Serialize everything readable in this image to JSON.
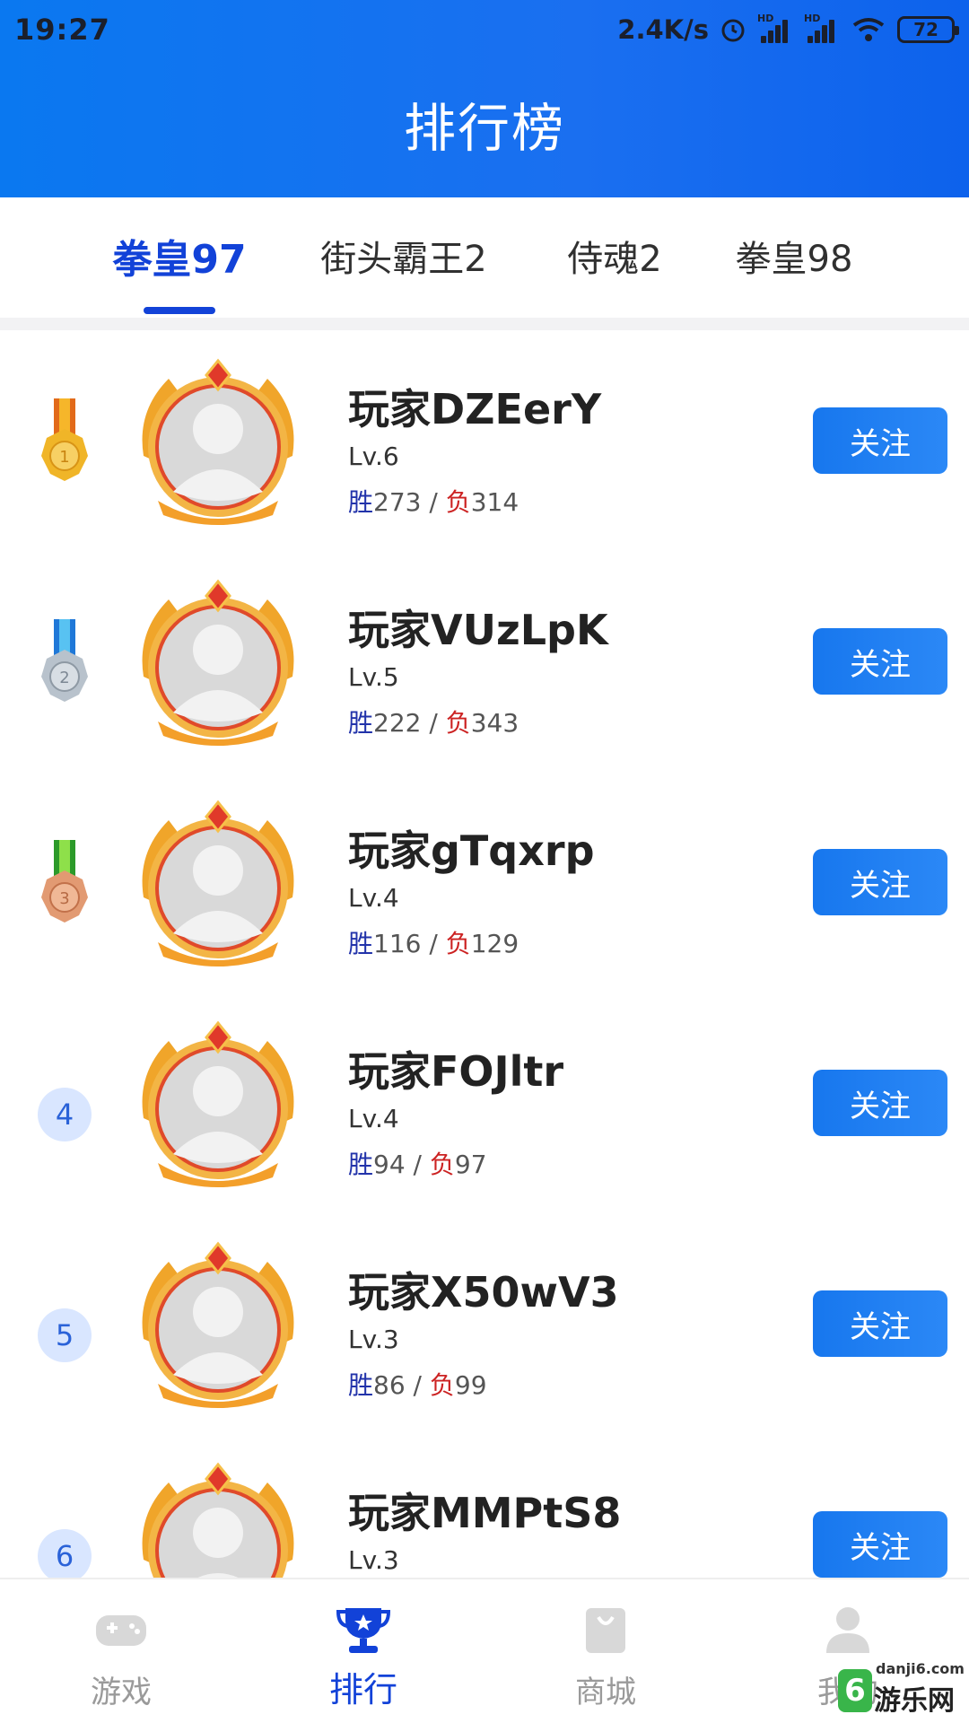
{
  "status_bar": {
    "time": "19:27",
    "network_speed": "2.4K/s",
    "hd_label": "HD",
    "battery": "72"
  },
  "header": {
    "title": "排行榜"
  },
  "tabs": [
    {
      "label": "拳皇97",
      "active": true
    },
    {
      "label": "街头霸王2",
      "active": false
    },
    {
      "label": "侍魂2",
      "active": false
    },
    {
      "label": "拳皇98",
      "active": false
    }
  ],
  "ranking": {
    "win_label": "胜",
    "lose_label": "负",
    "separator": " / ",
    "follow_label": "关注",
    "players": [
      {
        "rank": "1",
        "medal": "gold-medal-icon",
        "name": "玩家DZEerY",
        "level": "Lv.6",
        "wins": "273",
        "losses": "314"
      },
      {
        "rank": "2",
        "medal": "silver-medal-icon",
        "name": "玩家VUzLpK",
        "level": "Lv.5",
        "wins": "222",
        "losses": "343"
      },
      {
        "rank": "3",
        "medal": "bronze-medal-icon",
        "name": "玩家gTqxrp",
        "level": "Lv.4",
        "wins": "116",
        "losses": "129"
      },
      {
        "rank": "4",
        "medal": "",
        "name": "玩家FOJltr",
        "level": "Lv.4",
        "wins": "94",
        "losses": "97"
      },
      {
        "rank": "5",
        "medal": "",
        "name": "玩家X50wV3",
        "level": "Lv.3",
        "wins": "86",
        "losses": "99"
      },
      {
        "rank": "6",
        "medal": "",
        "name": "玩家MMPtS8",
        "level": "Lv.3",
        "wins": "",
        "losses": ""
      }
    ]
  },
  "bottom_nav": [
    {
      "label": "游戏",
      "icon": "gamepad-icon",
      "active": false
    },
    {
      "label": "排行",
      "icon": "trophy-icon",
      "active": true
    },
    {
      "label": "商城",
      "icon": "shopping-bag-icon",
      "active": false
    },
    {
      "label": "我的",
      "icon": "user-icon",
      "active": false
    }
  ],
  "watermark": {
    "url": "danji6.com",
    "text": "游乐网",
    "logo": "6"
  },
  "colors": {
    "accent": "#1242d8",
    "header_blue": "#1a6ff0",
    "follow_button": "#1777ee",
    "win": "#2233aa",
    "loss": "#cc2222"
  }
}
